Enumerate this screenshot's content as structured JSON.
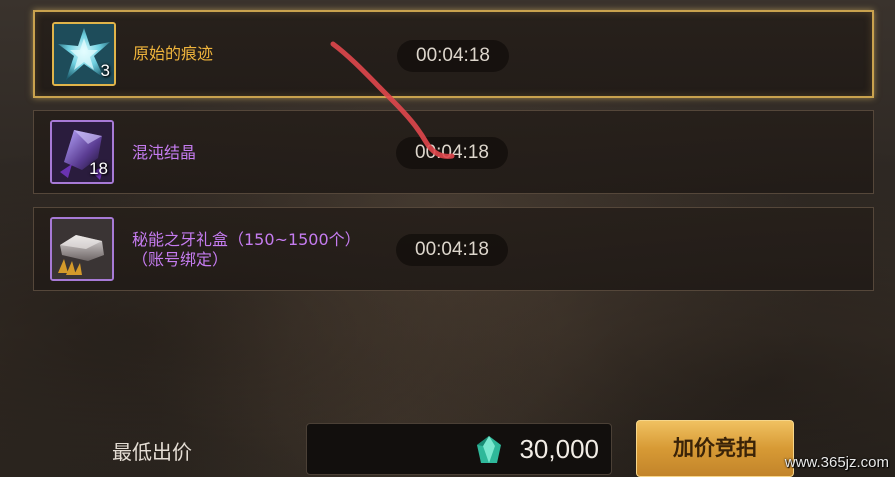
{
  "auction": {
    "items": [
      {
        "name": "原始的痕迹",
        "count": "3",
        "timer": "00:04:18",
        "rarity": "legendary",
        "name_color": "#efb43c",
        "icon": "crystal-shard-icon",
        "selected": true
      },
      {
        "name": "混沌结晶",
        "count": "18",
        "timer": "00:04:18",
        "rarity": "epic",
        "name_color": "#c57cf0",
        "icon": "chaos-crystal-icon",
        "selected": false
      },
      {
        "name_line1": "秘能之牙礼盒（150~1500个）",
        "name_line2": "（账号绑定）",
        "timer": "00:04:18",
        "rarity": "epic",
        "name_color": "#c57cf0",
        "icon": "fang-gift-box-icon",
        "selected": false
      }
    ]
  },
  "bid": {
    "min_label": "最低出价",
    "currency_icon": "gem-icon",
    "amount": "30,000",
    "raise_button_label": "加价竞拍"
  },
  "colors": {
    "selected_border": "#c9a24e",
    "button_gold": "#d79a35",
    "annotation_red": "#e0474c"
  },
  "watermark": "www.365jz.com"
}
